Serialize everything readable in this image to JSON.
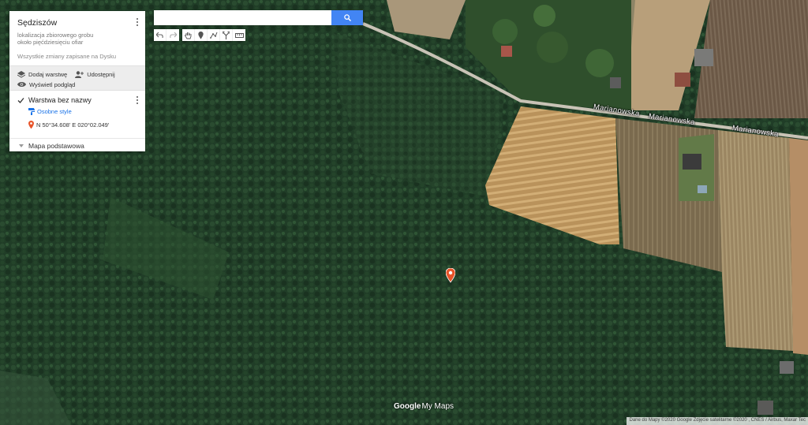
{
  "panel": {
    "title": "Sędziszów",
    "description_line1": "lokalizacja zbiorowego grobu",
    "description_line2": "około pięćdziesięciu ofiar",
    "save_status": "Wszystkie zmiany zapisane na Dysku",
    "actions": {
      "add_layer": "Dodaj warstwę",
      "share": "Udostępnij",
      "preview": "Wyświetl podgląd"
    },
    "layer": {
      "name": "Warstwa bez nazwy",
      "style_link": "Osobne style",
      "place": "N 50°34.608' E 020°02.049'"
    },
    "basemap_label": "Mapa podstawowa"
  },
  "search": {
    "value": "",
    "placeholder": ""
  },
  "toolbar": [
    "undo-icon",
    "redo-icon",
    "hand-icon",
    "marker-icon",
    "draw-line-icon",
    "directions-icon",
    "ruler-icon"
  ],
  "map": {
    "road_labels": [
      "Marianowska",
      "Marianowska",
      "Marianowska"
    ],
    "marker_color": "#e8542a"
  },
  "footer": {
    "logo_google": "Google",
    "logo_mymaps": "My Maps",
    "attribution": "Dane do Mapy ©2020 Google Zdjęcie satelitarne ©2020 , CNES / Airbus, Maxar Tec"
  },
  "colors": {
    "accent": "#4285f4",
    "link": "#1a73e8",
    "forest": "#1f3a26"
  }
}
